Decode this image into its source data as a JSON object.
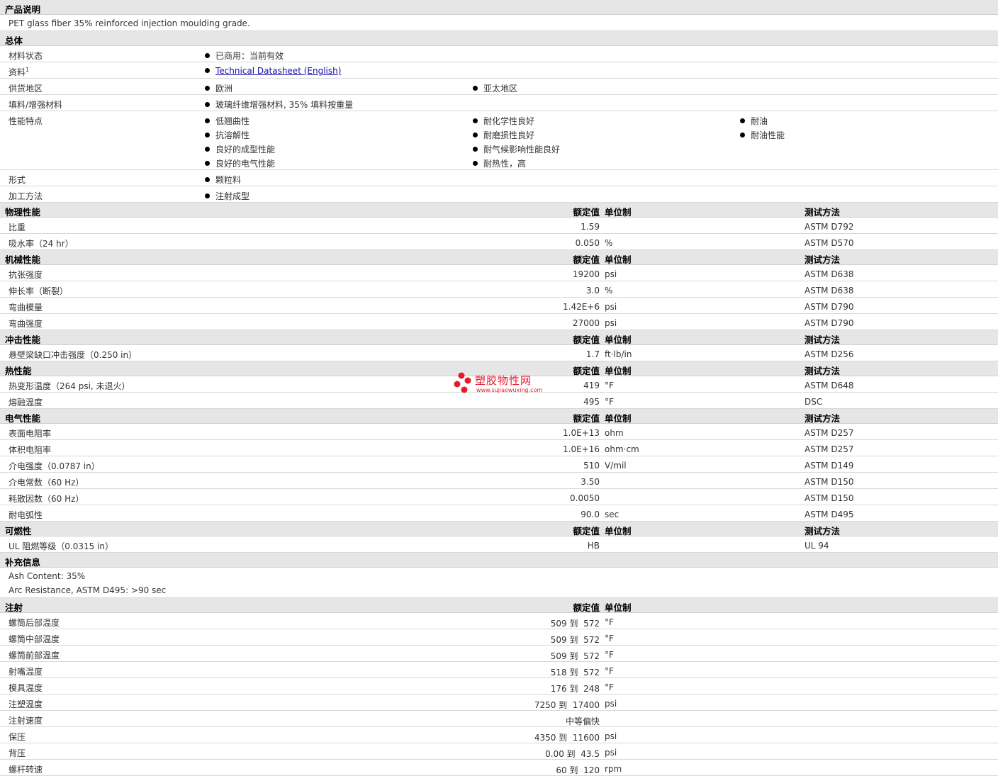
{
  "description": {
    "title": "产品说明",
    "text": "PET glass fiber 35% reinforced injection moulding grade."
  },
  "general": {
    "title": "总体",
    "rows": [
      {
        "label": "材料状态",
        "cols": [
          [
            "已商用：当前有效"
          ]
        ]
      },
      {
        "label": "资料",
        "sup": "1",
        "cols": [
          [
            "Technical Datasheet (English)"
          ]
        ],
        "link": true
      },
      {
        "label": "供货地区",
        "cols": [
          [
            "欧洲"
          ],
          [
            "亚太地区"
          ]
        ]
      },
      {
        "label": "填料/增强材料",
        "cols": [
          [
            "玻璃纤维增强材料, 35% 填料按重量"
          ]
        ]
      },
      {
        "label": "性能特点",
        "cols": [
          [
            "低翘曲性",
            "抗溶解性",
            "良好的成型性能",
            "良好的电气性能"
          ],
          [
            "耐化学性良好",
            "耐磨损性良好",
            "耐气候影响性能良好",
            "耐热性，高"
          ],
          [
            "耐油",
            "耐油性能"
          ]
        ]
      },
      {
        "label": "形式",
        "cols": [
          [
            "颗粒料"
          ]
        ]
      },
      {
        "label": "加工方法",
        "cols": [
          [
            "注射成型"
          ]
        ]
      }
    ]
  },
  "headers": {
    "value": "额定值",
    "unit": "单位制",
    "method": "测试方法"
  },
  "sections": [
    {
      "title": "物理性能",
      "rows": [
        {
          "label": "比重",
          "value": "1.59",
          "unit": "",
          "method": "ASTM D792"
        },
        {
          "label": "吸水率（24 hr）",
          "value": "0.050",
          "unit": "%",
          "method": "ASTM D570"
        }
      ]
    },
    {
      "title": "机械性能",
      "rows": [
        {
          "label": "抗张强度",
          "value": "19200",
          "unit": "psi",
          "method": "ASTM D638"
        },
        {
          "label": "伸长率（断裂）",
          "value": "3.0",
          "unit": "%",
          "method": "ASTM D638"
        },
        {
          "label": "弯曲模量",
          "value": "1.42E+6",
          "unit": "psi",
          "method": "ASTM D790"
        },
        {
          "label": "弯曲强度",
          "value": "27000",
          "unit": "psi",
          "method": "ASTM D790"
        }
      ]
    },
    {
      "title": "冲击性能",
      "rows": [
        {
          "label": "悬壁梁缺口冲击强度（0.250 in）",
          "value": "1.7",
          "unit": "ft·lb/in",
          "method": "ASTM D256"
        }
      ]
    },
    {
      "title": "热性能",
      "rows": [
        {
          "label": "热变形温度（264 psi, 未退火）",
          "value": "419",
          "unit": "°F",
          "method": "ASTM D648"
        },
        {
          "label": "熔融温度",
          "value": "495",
          "unit": "°F",
          "method": "DSC"
        }
      ]
    },
    {
      "title": "电气性能",
      "rows": [
        {
          "label": "表面电阻率",
          "value": "1.0E+13",
          "unit": "ohm",
          "method": "ASTM D257"
        },
        {
          "label": "体积电阻率",
          "value": "1.0E+16",
          "unit": "ohm·cm",
          "method": "ASTM D257"
        },
        {
          "label": "介电强度（0.0787 in）",
          "value": "510",
          "unit": "V/mil",
          "method": "ASTM D149"
        },
        {
          "label": "介电常数（60 Hz）",
          "value": "3.50",
          "unit": "",
          "method": "ASTM D150"
        },
        {
          "label": "耗散因数（60 Hz）",
          "value": "0.0050",
          "unit": "",
          "method": "ASTM D150"
        },
        {
          "label": "耐电弧性",
          "value": "90.0",
          "unit": "sec",
          "method": "ASTM D495"
        }
      ]
    },
    {
      "title": "可燃性",
      "rows": [
        {
          "label": "UL 阻燃等级（0.0315 in）",
          "value": "HB",
          "unit": "",
          "method": "UL 94"
        }
      ]
    }
  ],
  "supplement": {
    "title": "补充信息",
    "lines": [
      "Ash Content: 35%",
      "Arc Resistance, ASTM D495: >90 sec"
    ]
  },
  "injection": {
    "title": "注射",
    "rows": [
      {
        "label": "螺筒后部温度",
        "value": "509 到  572",
        "unit": "°F"
      },
      {
        "label": "螺筒中部温度",
        "value": "509 到  572",
        "unit": "°F"
      },
      {
        "label": "螺筒前部温度",
        "value": "509 到  572",
        "unit": "°F"
      },
      {
        "label": "射嘴温度",
        "value": "518 到  572",
        "unit": "°F"
      },
      {
        "label": "模具温度",
        "value": "176 到  248",
        "unit": "°F"
      },
      {
        "label": "注塑温度",
        "value": "7250 到  17400",
        "unit": "psi"
      },
      {
        "label": "注射速度",
        "value": "中等偏快",
        "unit": ""
      },
      {
        "label": "保压",
        "value": "4350 到  11600",
        "unit": "psi"
      },
      {
        "label": "背压",
        "value": "0.00 到  43.5",
        "unit": "psi"
      },
      {
        "label": "螺杆转速",
        "value": "60 到  120",
        "unit": "rpm"
      }
    ]
  },
  "watermark": {
    "name": "塑胶物性网",
    "url": "www.sujiaowuxing.com",
    "color": "#e8192c"
  }
}
